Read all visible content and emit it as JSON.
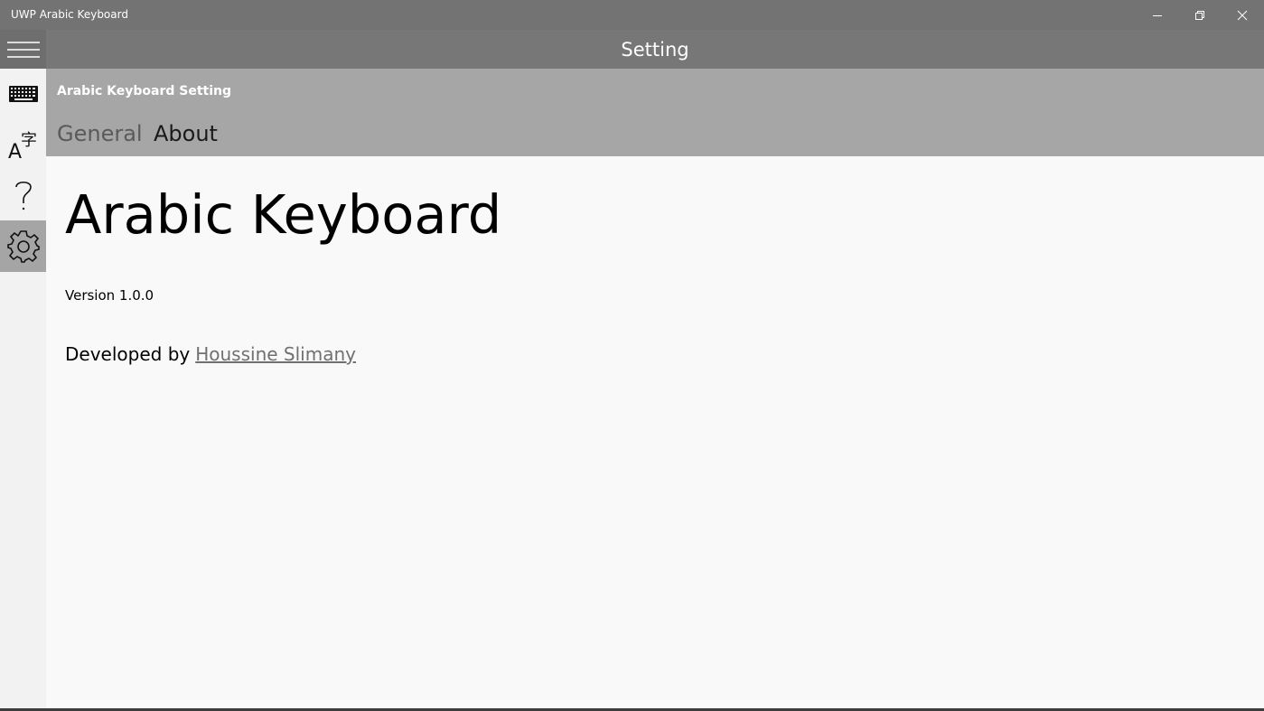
{
  "window": {
    "title": "UWP Arabic Keyboard"
  },
  "header": {
    "title": "Setting"
  },
  "sidebar": {
    "items": [
      {
        "icon": "hamburger-menu-icon"
      },
      {
        "icon": "keyboard-icon"
      },
      {
        "icon": "language-icon"
      },
      {
        "icon": "help-icon"
      },
      {
        "icon": "gear-icon",
        "selected": true
      }
    ]
  },
  "pivot": {
    "title": "Arabic Keyboard Setting",
    "tabs": [
      {
        "label": "General",
        "selected": false
      },
      {
        "label": "About",
        "selected": true
      }
    ]
  },
  "about": {
    "app_name": "Arabic Keyboard",
    "version": "Version 1.0.0",
    "developed_by": "Developed by",
    "developer": "Houssine Slimany"
  },
  "colors": {
    "titlebar": "#737373",
    "header": "#777777",
    "subheader": "#a6a6a6",
    "selected_nav": "#a5a5a5",
    "content_bg": "#f9f9f9",
    "link": "#707070"
  }
}
